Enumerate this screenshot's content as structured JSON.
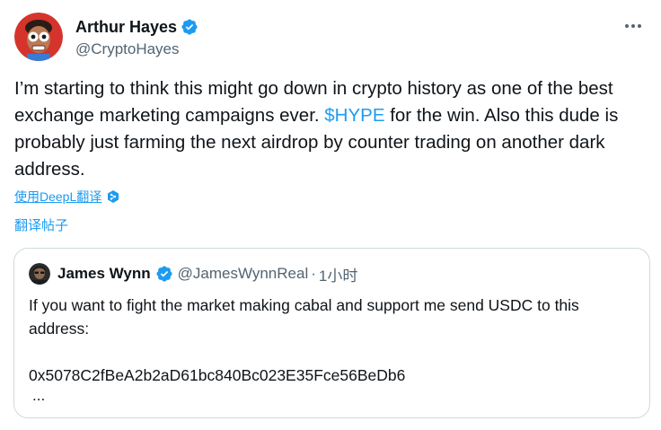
{
  "tweet": {
    "author_name": "Arthur Hayes",
    "author_handle": "@CryptoHayes",
    "text_before": "I’m starting to think this might go down in crypto history as one of the best exchange marketing campaigns ever. ",
    "cashtag": "$HYPE",
    "text_after": " for the win. Also this dude is probably just farming the next airdrop by counter trading on another dark address.",
    "translate_deepl": "使用DeepL翻译",
    "translate_post": "翻译帖子"
  },
  "quote": {
    "author_name": "James Wynn",
    "author_handle": "@JamesWynnReal",
    "separator": "·",
    "time": "1小时",
    "text": "If you want to fight the market making cabal and support me send USDC to this address:\n\n0x5078C2fBeA2b2aD61bc840Bc023E35Fce56BeDb6",
    "ellipsis": "..."
  },
  "icons": {
    "verified": "verified-badge-icon",
    "more": "more-options-icon",
    "deepl": "deepl-icon"
  },
  "colors": {
    "accent": "#1d9bf0",
    "text": "#0f1419",
    "muted": "#536471",
    "border": "#cfd9de"
  }
}
